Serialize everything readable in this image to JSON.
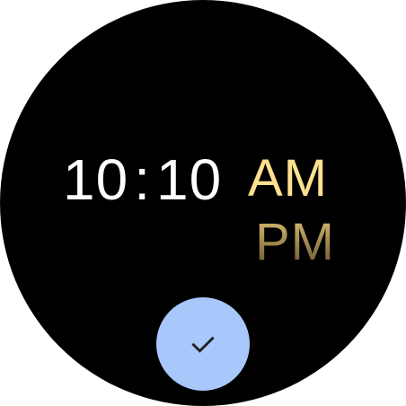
{
  "time": {
    "hours": "10",
    "separator": ":",
    "minutes": "10",
    "am_label": "AM",
    "pm_label": "PM",
    "selected_period": "AM"
  },
  "confirm": {
    "icon": "check-icon"
  },
  "colors": {
    "background": "#000000",
    "time_text": "#ffffff",
    "am_selected": "#ffe08f",
    "pm_unselected": "#b89a55",
    "confirm_button": "#a8c7fa",
    "check_icon": "#1f1f1f"
  }
}
